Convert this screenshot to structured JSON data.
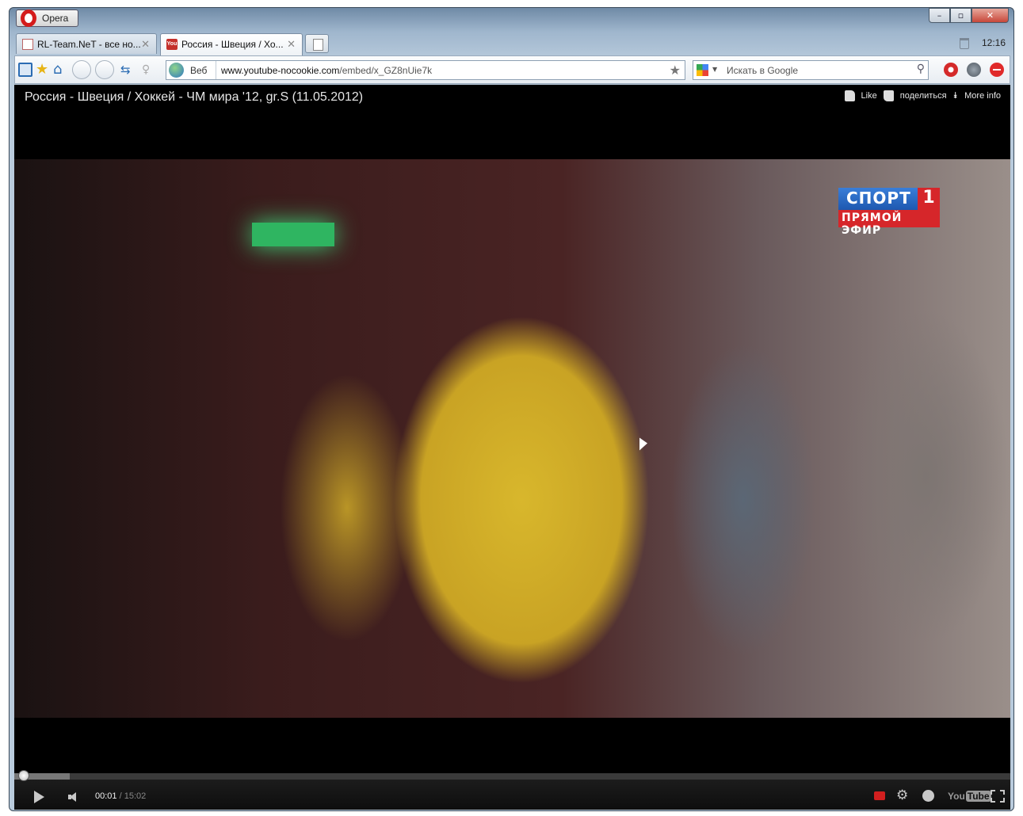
{
  "browser": {
    "app_name": "Opera",
    "clock": "12:16",
    "tabs": [
      {
        "label": "RL-Team.NeT - все но...",
        "icon": "doc-icon",
        "active": false
      },
      {
        "label": "Россия - Швеция / Хо...",
        "icon": "youtube-icon",
        "active": true
      }
    ],
    "address": {
      "scope_label": "Веб",
      "url_domain": "www.youtube-nocookie.com",
      "url_path": "/embed/x_GZ8nUie7k"
    },
    "search": {
      "placeholder": "Искать в Google",
      "engine": "Google"
    }
  },
  "player": {
    "title": "Россия - Швеция / Хоккей - ЧМ мира '12, gr.S (11.05.2012)",
    "actions": {
      "like": "Like",
      "share": "поделиться",
      "more_info": "More info"
    },
    "overlay_logo": {
      "brand": "СПОРТ",
      "number": "1",
      "subtitle": "ПРЯМОЙ ЭФИР"
    },
    "controls": {
      "current_time": "00:01",
      "duration": "15:02",
      "progress_fraction": 0.001,
      "buffered_fraction": 0.056,
      "logo": "YouTube"
    }
  },
  "colors": {
    "youtube_red": "#c4302b",
    "opera_red": "#d41b1b",
    "channel_blue": "#1e58b0",
    "channel_red": "#d6262a"
  }
}
